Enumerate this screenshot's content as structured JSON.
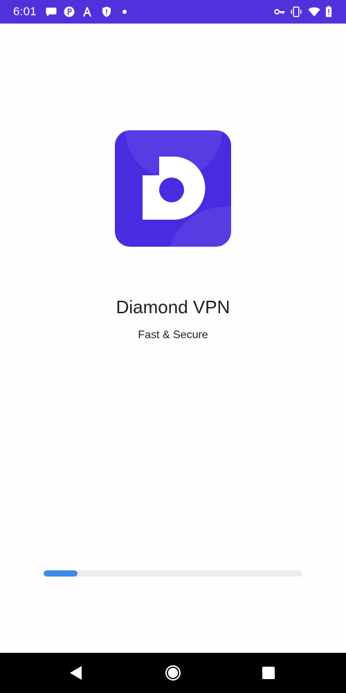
{
  "status_bar": {
    "time": "6:01",
    "background": "#5231dc",
    "left_icons": [
      "chat-bubble-icon",
      "p-app-icon",
      "a-app-icon",
      "shield-alert-icon",
      "dot-icon"
    ],
    "right_icons": [
      "vpn-key-icon",
      "vibrate-icon",
      "wifi-icon",
      "battery-icon"
    ]
  },
  "app": {
    "title": "Diamond VPN",
    "subtitle": "Fast & Secure",
    "logo_colors": {
      "background": "#4a2be0",
      "letter": "#ffffff"
    }
  },
  "progress": {
    "value": 0.13,
    "fill_color": "#3f8bea",
    "track_color": "#eeecef"
  },
  "nav_bar": {
    "buttons": [
      "back-icon",
      "home-icon",
      "recents-icon"
    ]
  }
}
